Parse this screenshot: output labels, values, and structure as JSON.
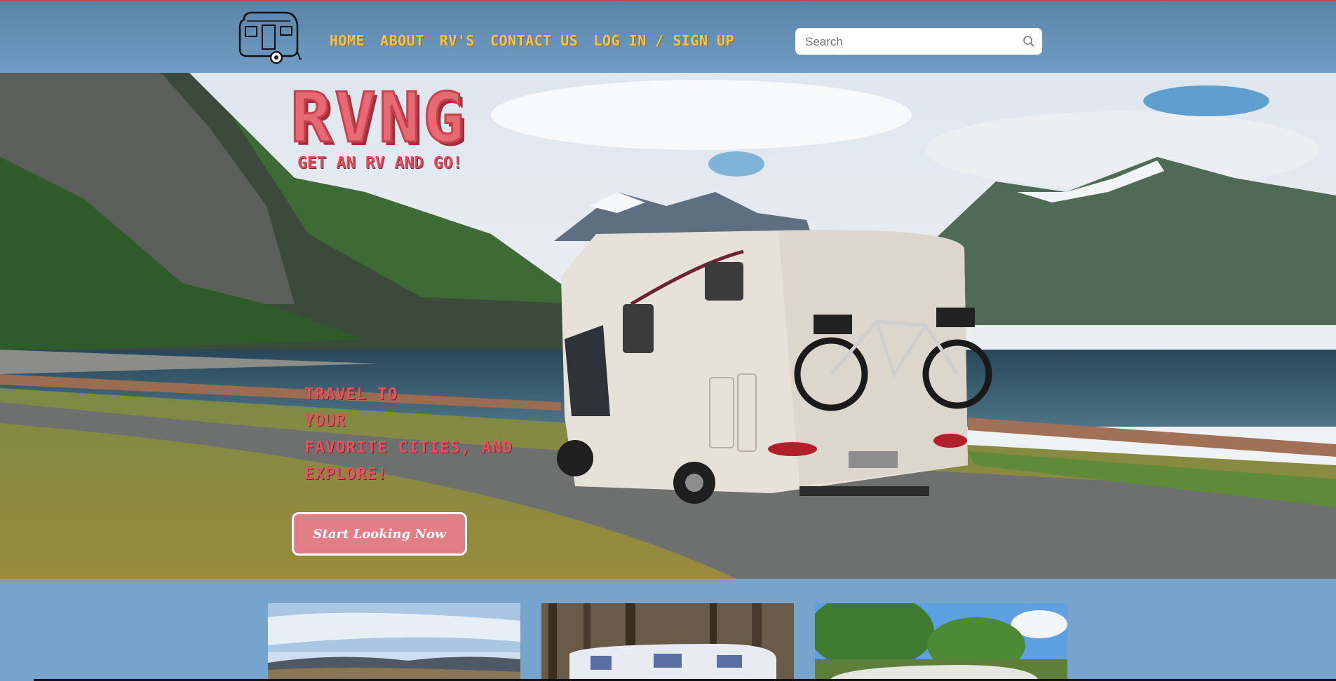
{
  "header": {
    "logo_icon": "camper-trailer-icon",
    "nav": [
      {
        "label": "HOME"
      },
      {
        "label": "ABOUT"
      },
      {
        "label": "RV'S"
      },
      {
        "label": "CONTACT US"
      },
      {
        "label": "LOG IN / SIGN UP"
      }
    ],
    "search": {
      "placeholder": "Search",
      "icon": "search-icon"
    }
  },
  "hero": {
    "brand": "RVNG",
    "tagline": "GET AN RV AND GO!",
    "travel_lines": [
      "TRAVEL TO",
      "YOUR",
      "FAVORITE CITIES, AND",
      "EXPLORE!"
    ],
    "cta_label": "Start Looking Now"
  },
  "cards": [
    {
      "image": "landscape-hills-photo"
    },
    {
      "image": "camper-in-forest-photo"
    },
    {
      "image": "trailer-under-trees-photo"
    }
  ],
  "colors": {
    "header_bg": "#5b84a7",
    "nav_text": "#f3c34a",
    "brand_red": "#e56a74",
    "cta_bg": "#e27e86",
    "page_bg": "#77a4cc"
  }
}
